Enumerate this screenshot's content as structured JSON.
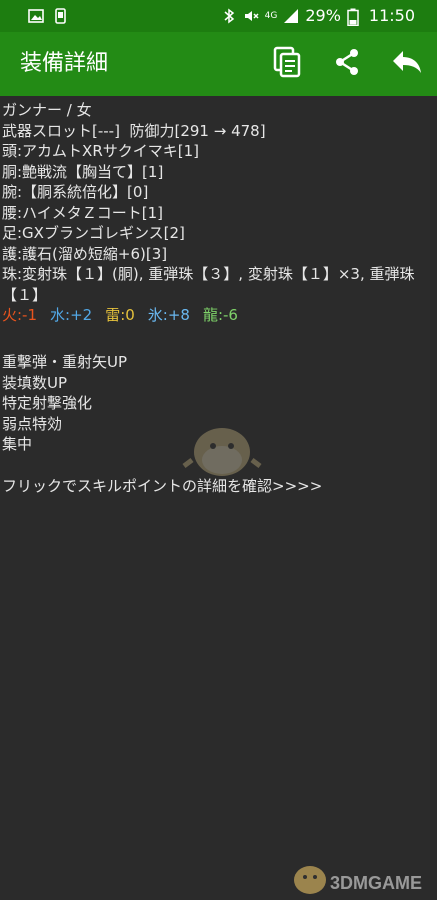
{
  "status_bar": {
    "network": "4G",
    "battery": "29%",
    "time": "11:50"
  },
  "app_bar": {
    "title": "装備詳細"
  },
  "details": {
    "class_line": "ガンナー / 女",
    "weapon_line": "武器スロット[---]  防御力[291 → 478]",
    "head": "頭:アカムトXRサクイマキ[1]",
    "body": "胴:艶戦流【胸当て】[1]",
    "arms": "腕:【胴系統倍化】[0]",
    "waist": "腰:ハイメタＺコート[1]",
    "legs": "足:GXブランゴレギンス[2]",
    "charm": "護:護石(溜め短縮+6)[3]",
    "jewels": "珠:変射珠【１】(胴), 重弾珠【３】, 変射珠【１】×3, 重弾珠【１】"
  },
  "resistances": [
    {
      "label": "火:-1",
      "color": "#e8541e"
    },
    {
      "label": "水:+2",
      "color": "#52a8e6"
    },
    {
      "label": "雷:0",
      "color": "#e6c23c"
    },
    {
      "label": "氷:+8",
      "color": "#6ab8f0"
    },
    {
      "label": "龍:-6",
      "color": "#7fd36a"
    }
  ],
  "skills": [
    "重撃弾・重射矢UP",
    "装填数UP",
    "特定射撃強化",
    "弱点特効",
    "集中"
  ],
  "skill_point_link": "フリックでスキルポイントの詳細を確認>>>>",
  "watermark": "3DMGAME"
}
